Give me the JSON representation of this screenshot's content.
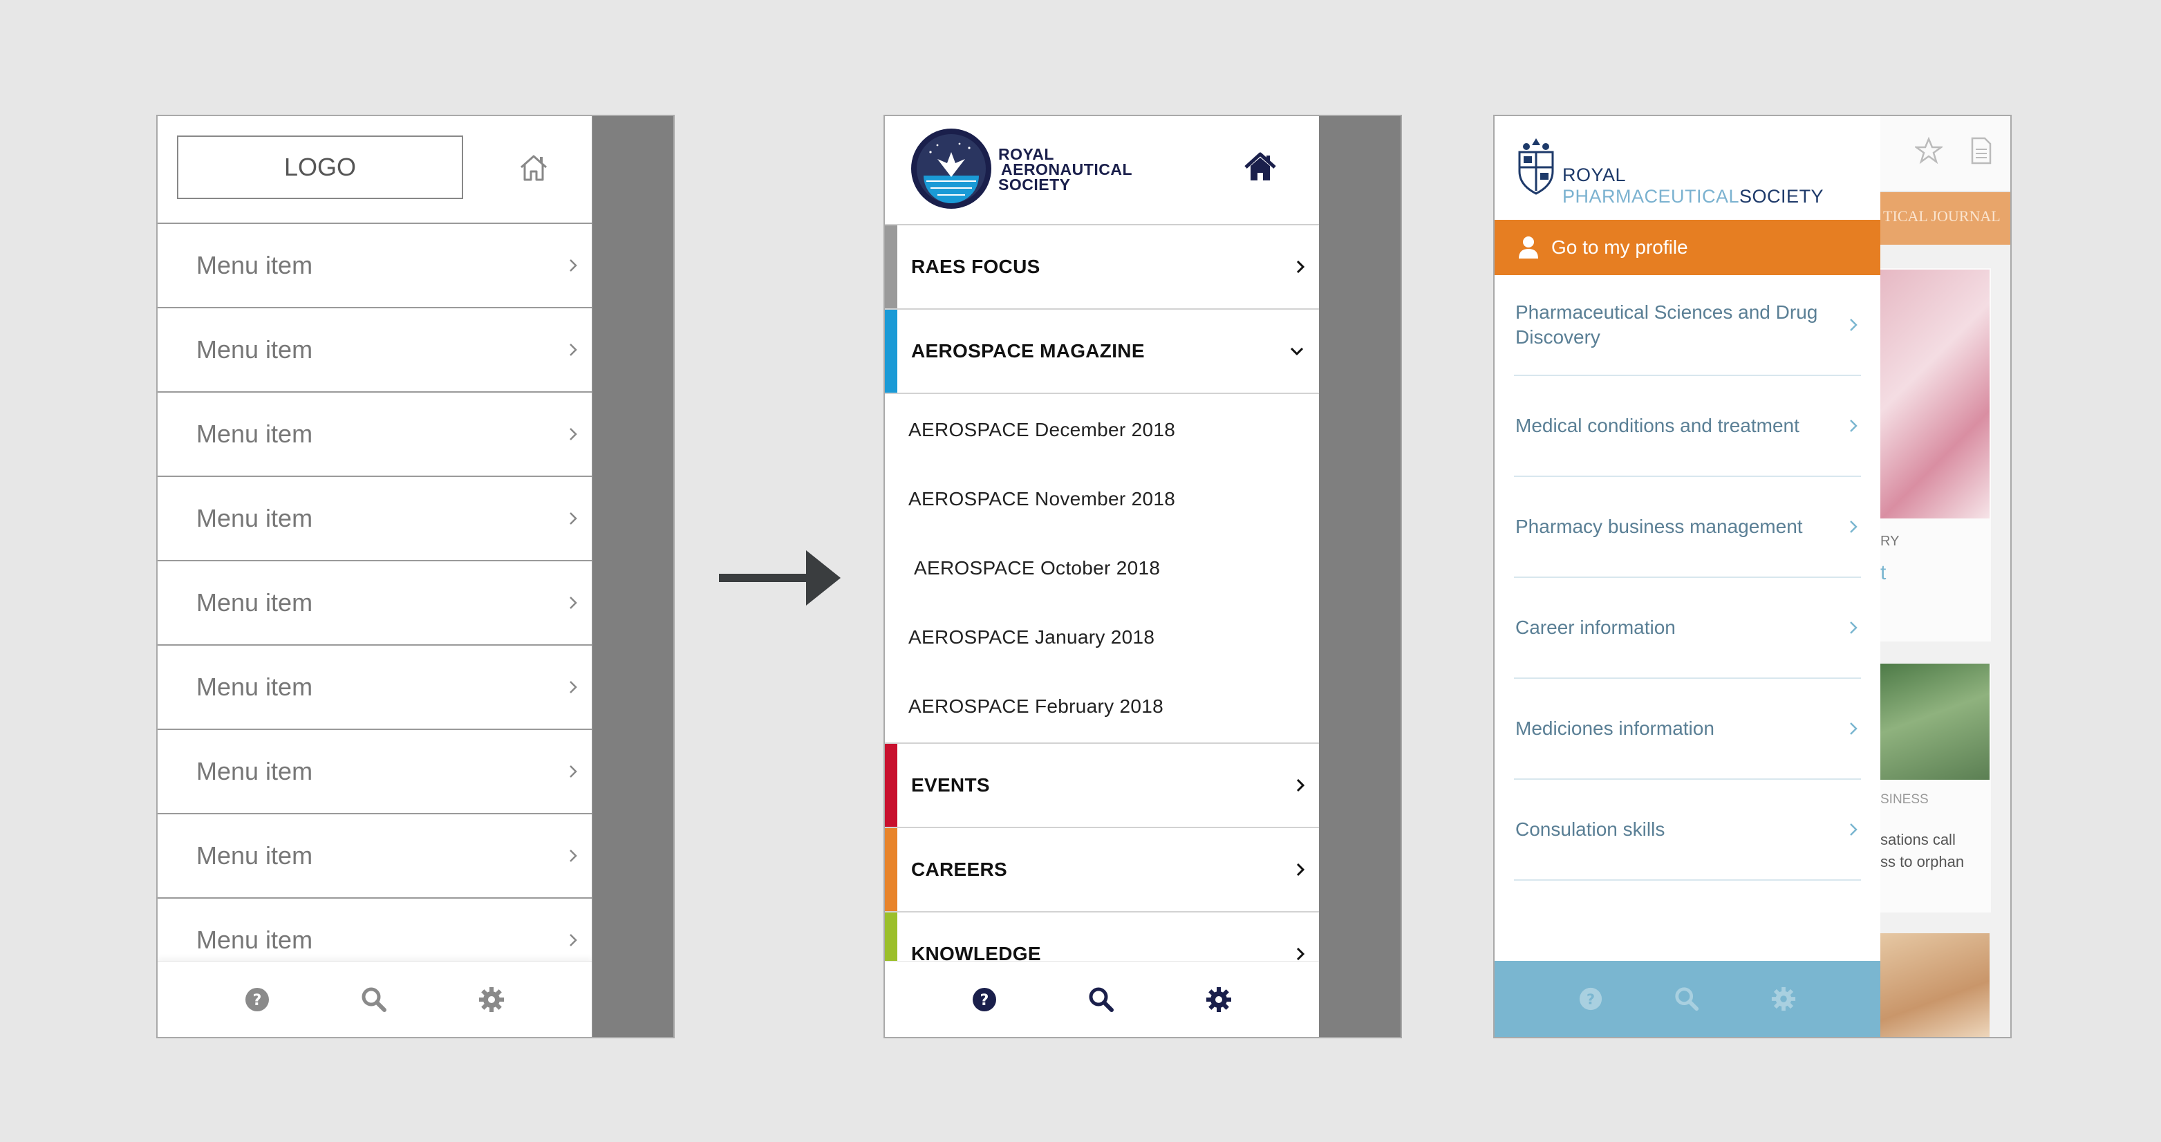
{
  "wireframe": {
    "logo_label": "LOGO",
    "menu_items": [
      "Menu item",
      "Menu item",
      "Menu item",
      "Menu item",
      "Menu item",
      "Menu item",
      "Menu item",
      "Menu item",
      "Menu item"
    ],
    "footer_icons": [
      "help-icon",
      "search-icon",
      "gear-icon"
    ]
  },
  "raes": {
    "brand_line1": "ROYAL",
    "brand_line2": "AERONAUTICAL",
    "brand_line3": "SOCIETY",
    "items": [
      {
        "label": "RAES FOCUS",
        "color": "#9a9a9a",
        "state": "collapsed"
      },
      {
        "label": "AEROSPACE MAGAZINE",
        "color": "#1a9ad6",
        "state": "expanded"
      },
      {
        "label": "EVENTS",
        "color": "#c8102e",
        "state": "collapsed"
      },
      {
        "label": "CAREERS",
        "color": "#e8842a",
        "state": "collapsed"
      },
      {
        "label": "KNOWLEDGE",
        "color": "#9bbf2a",
        "state": "collapsed"
      }
    ],
    "sub_items": [
      "AEROSPACE December 2018",
      "AEROSPACE November 2018",
      "AEROSPACE October 2018",
      "AEROSPACE January 2018",
      "AEROSPACE February 2018"
    ],
    "accent": "#1a1f4b"
  },
  "rps": {
    "brand_part1": "ROYAL",
    "brand_part2": "PHARMACEUTICAL",
    "brand_part3": "SOCIETY",
    "profile_label": "Go to my profile",
    "items": [
      "Pharmaceutical Sciences and Drug Discovery",
      "Medical conditions and treatment",
      "Pharmacy business management",
      "Career information",
      "Mediciones information",
      "Consulation skills"
    ],
    "background": {
      "banner_text": "TICAL JOURNAL",
      "snippet1": "RY",
      "snippet2": "t",
      "snippet3": "SINESS",
      "snippet4": "sations call",
      "snippet5": "ss to orphan"
    },
    "accent": "#e67e22",
    "footer_color": "#7ab6d0"
  }
}
